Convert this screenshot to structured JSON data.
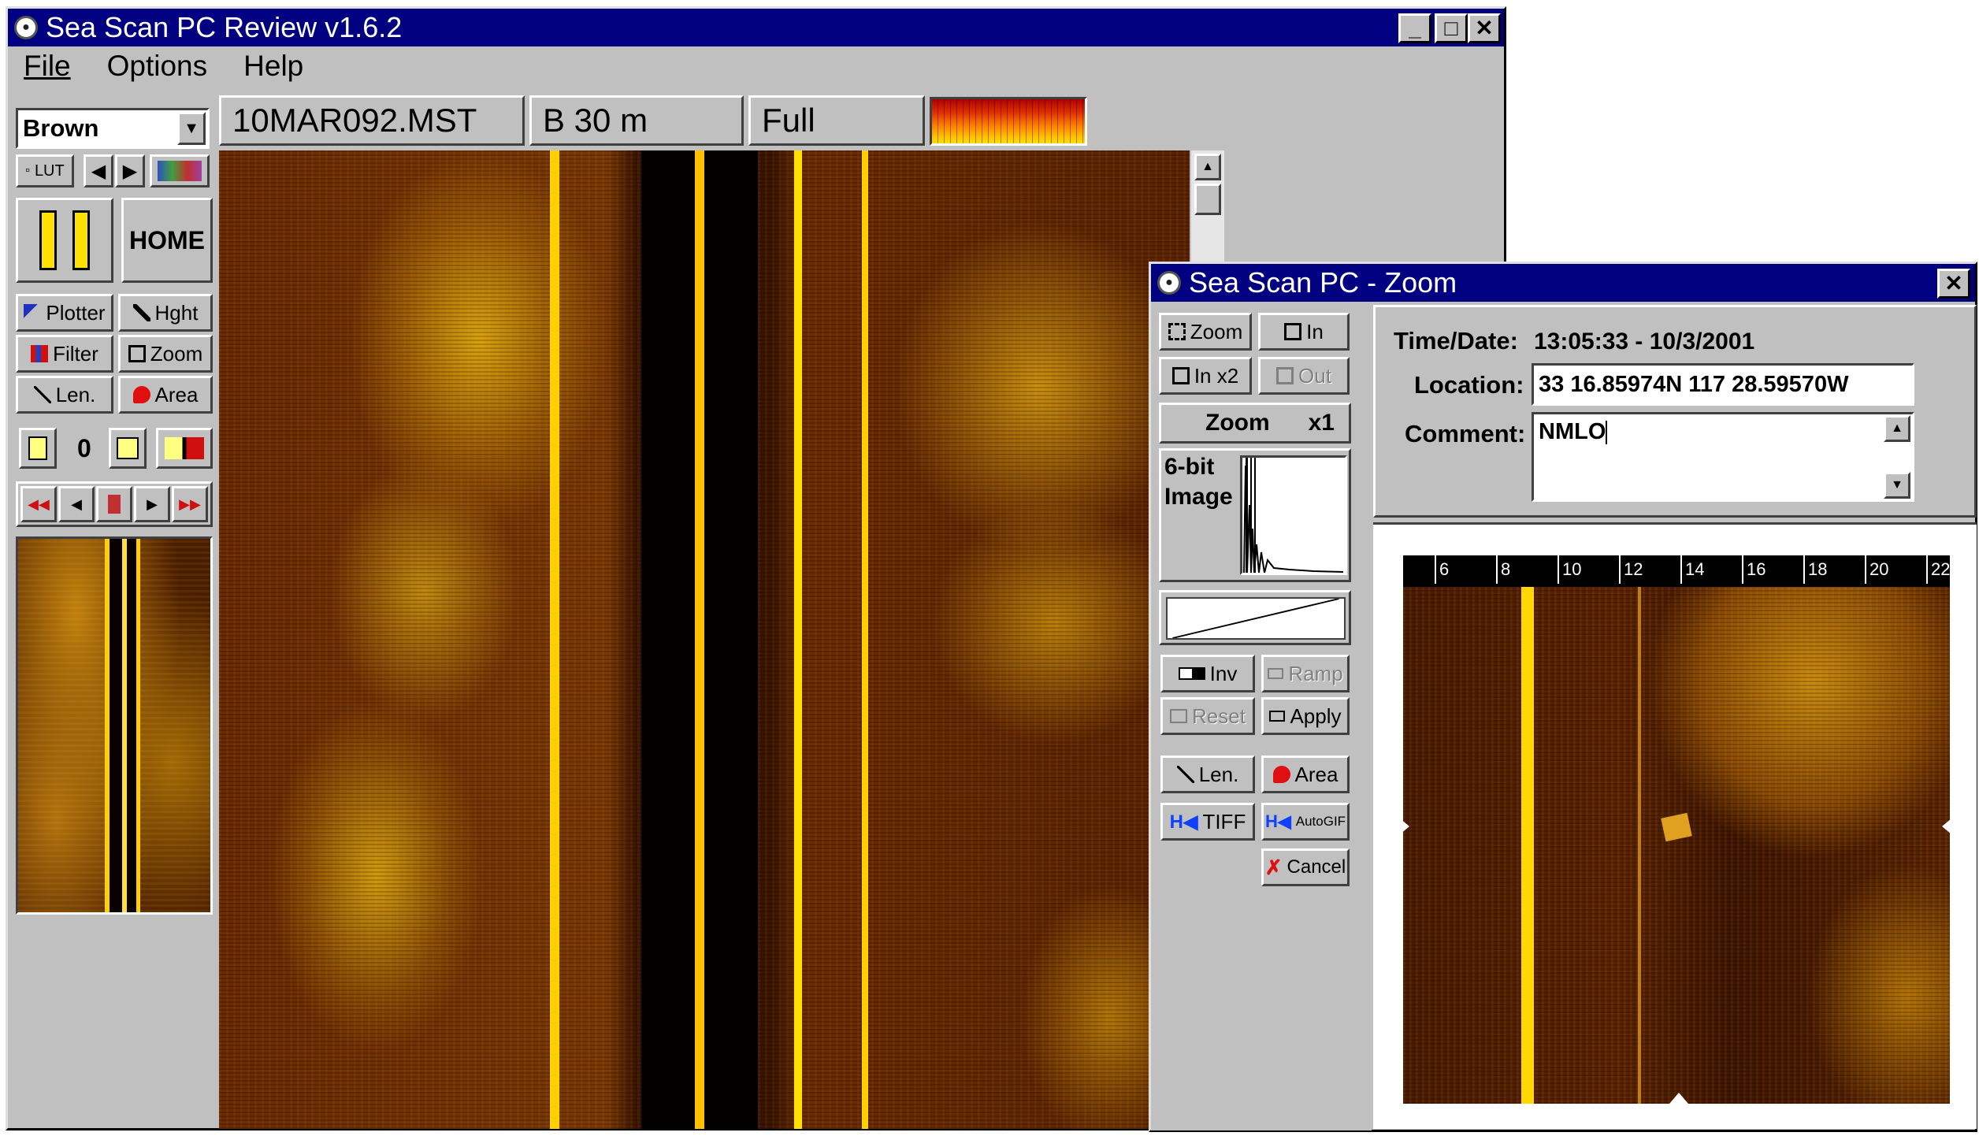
{
  "main_window": {
    "title": "Sea Scan PC Review v1.6.2",
    "menu": [
      "File",
      "Options",
      "Help"
    ],
    "palette_select": "Brown",
    "lut_label": "LUT",
    "home_label": "HOME",
    "file_name": "10MAR092.MST",
    "range": "B 30 m",
    "view_mode": "Full",
    "tools": [
      {
        "label": "Plotter",
        "icon": "plotter-icon"
      },
      {
        "label": "Hght",
        "icon": "height-icon"
      },
      {
        "label": "Filter",
        "icon": "filter-icon"
      },
      {
        "label": "Zoom",
        "icon": "zoom-icon"
      },
      {
        "label": "Len.",
        "icon": "length-icon"
      },
      {
        "label": "Area",
        "icon": "area-icon"
      }
    ],
    "marker_count": "0"
  },
  "zoom_window": {
    "title": "Sea Scan PC - Zoom",
    "buttons": {
      "zoom": "Zoom",
      "in": "In",
      "in_x2": "In x2",
      "out": "Out",
      "inv": "Inv",
      "ramp": "Ramp",
      "reset": "Reset",
      "apply": "Apply",
      "len": "Len.",
      "area": "Area",
      "tiff": "TIFF",
      "autogif": "AutoGIF",
      "cancel": "Cancel"
    },
    "zoom_label": "Zoom",
    "zoom_factor": "x1",
    "image_depth_line1": "6-bit",
    "image_depth_line2": "Image",
    "time_label": "Time/Date:",
    "time_value": "13:05:33 - 10/3/2001",
    "location_label": "Location:",
    "location_value": "33 16.85974N 117 28.59570W",
    "comment_label": "Comment:",
    "comment_value": "NMLO",
    "ruler_ticks": [
      "6",
      "8",
      "10",
      "12",
      "14",
      "16",
      "18",
      "20",
      "22"
    ]
  },
  "colors": {
    "title_bar": "#000080",
    "window_face": "#c0c0c0",
    "sonar_dark": "#2a0f00",
    "sonar_bright": "#ffd000"
  }
}
